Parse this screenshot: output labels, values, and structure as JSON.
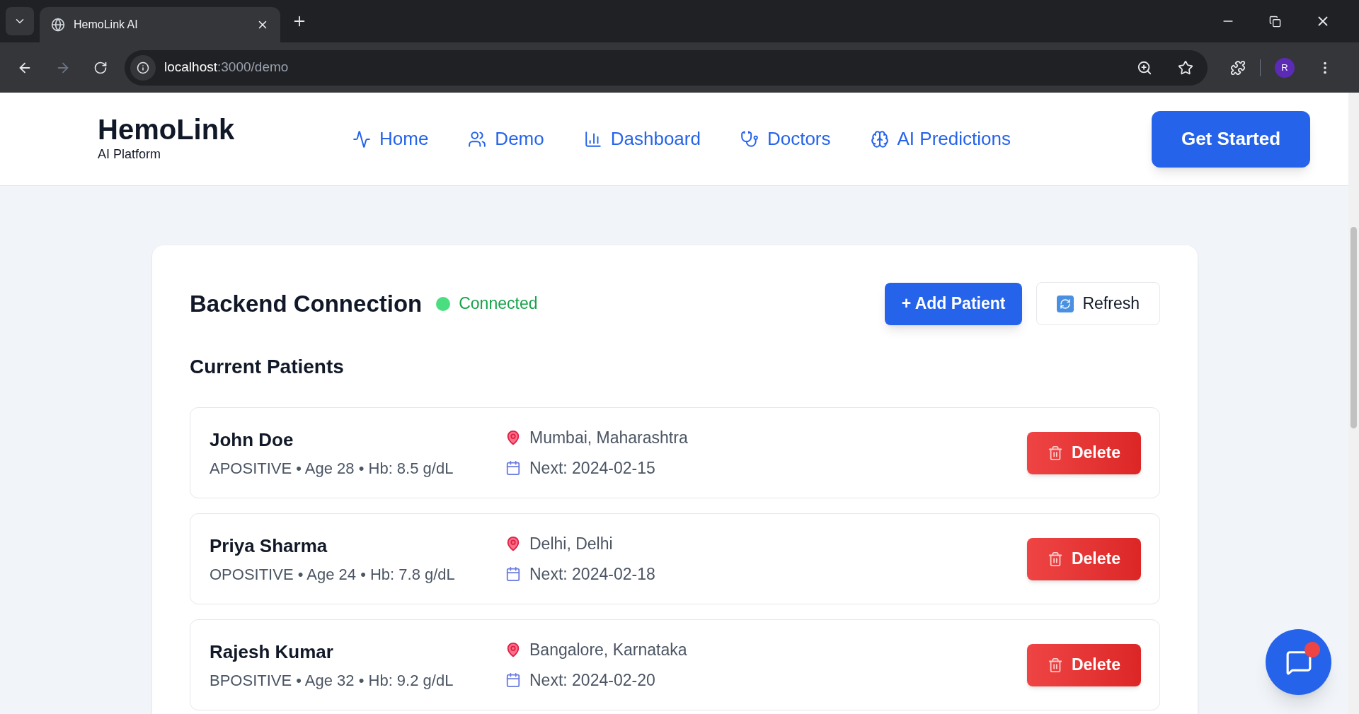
{
  "browser": {
    "tab_title": "HemoLink AI",
    "url_host": "localhost",
    "url_path": ":3000/demo",
    "profile_initial": "R"
  },
  "navbar": {
    "brand": "HemoLink",
    "tagline": "AI Platform",
    "links": [
      {
        "label": "Home",
        "kind": "pulse"
      },
      {
        "label": "Demo",
        "kind": "users"
      },
      {
        "label": "Dashboard",
        "kind": "chart"
      },
      {
        "label": "Doctors",
        "kind": "stethoscope"
      },
      {
        "label": "AI Predictions",
        "kind": "brain"
      }
    ],
    "cta": "Get Started"
  },
  "connection": {
    "title": "Backend Connection",
    "status": "Connected",
    "connected": true,
    "add_button": "+ Add Patient",
    "refresh_button": "Refresh"
  },
  "patients": {
    "heading": "Current Patients",
    "rows": [
      {
        "name": "John Doe",
        "details": "APOSITIVE • Age 28 • Hb: 8.5 g/dL",
        "location": "Mumbai, Maharashtra",
        "next": "Next: 2024-02-15",
        "action": "Delete"
      },
      {
        "name": "Priya Sharma",
        "details": "OPOSITIVE • Age 24 • Hb: 7.8 g/dL",
        "location": "Delhi, Delhi",
        "next": "Next: 2024-02-18",
        "action": "Delete"
      },
      {
        "name": "Rajesh Kumar",
        "details": "BPOSITIVE • Age 32 • Hb: 9.2 g/dL",
        "location": "Bangalore, Karnataka",
        "next": "Next: 2024-02-20",
        "action": "Delete"
      }
    ]
  },
  "chat": {
    "unread": true
  }
}
